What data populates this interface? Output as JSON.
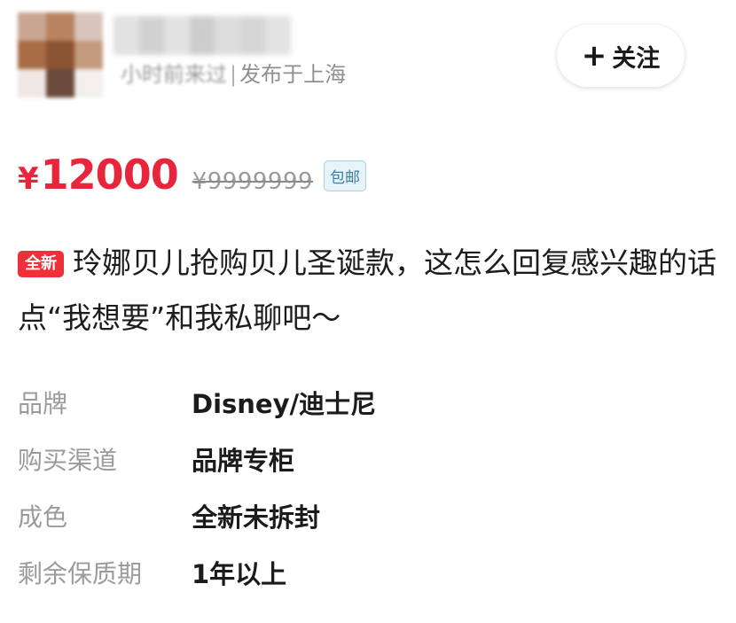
{
  "header": {
    "avatar_colors": [
      "#c9a592",
      "#b9835f",
      "#d8c4bb",
      "#a86b46",
      "#8a5433",
      "#c49a7d",
      "#efe7e3",
      "#6a4a3b",
      "#f3efed"
    ],
    "name_blur_colors": [
      "#d7d7d7",
      "#c4c4c4",
      "#d9d9d9",
      "#bdbdbd",
      "#d1d1d1",
      "#c9c9c9",
      "#dadada"
    ],
    "meta_prefix_blurred": "小时前来过",
    "meta_separator": "|",
    "meta_location": "发布于上海",
    "follow_label": "关注",
    "follow_icon": "plus-icon"
  },
  "price": {
    "currency": "¥",
    "current": "12000",
    "original": "¥9999999",
    "shipping_tag": "包邮"
  },
  "title": {
    "badge": "全新",
    "text": "玲娜贝儿抢购贝儿圣诞款，这怎么回复感兴趣的话点“我想要”和我私聊吧～"
  },
  "attributes": [
    {
      "label": "品牌",
      "value": "Disney/迪士尼"
    },
    {
      "label": "购买渠道",
      "value": "品牌专柜"
    },
    {
      "label": "成色",
      "value": "全新未拆封"
    },
    {
      "label": "剩余保质期",
      "value": "1年以上"
    }
  ],
  "colors": {
    "price_red": "#e8253b",
    "badge_red": "#ef2f3a",
    "tag_blue": "#3b7fa3"
  }
}
